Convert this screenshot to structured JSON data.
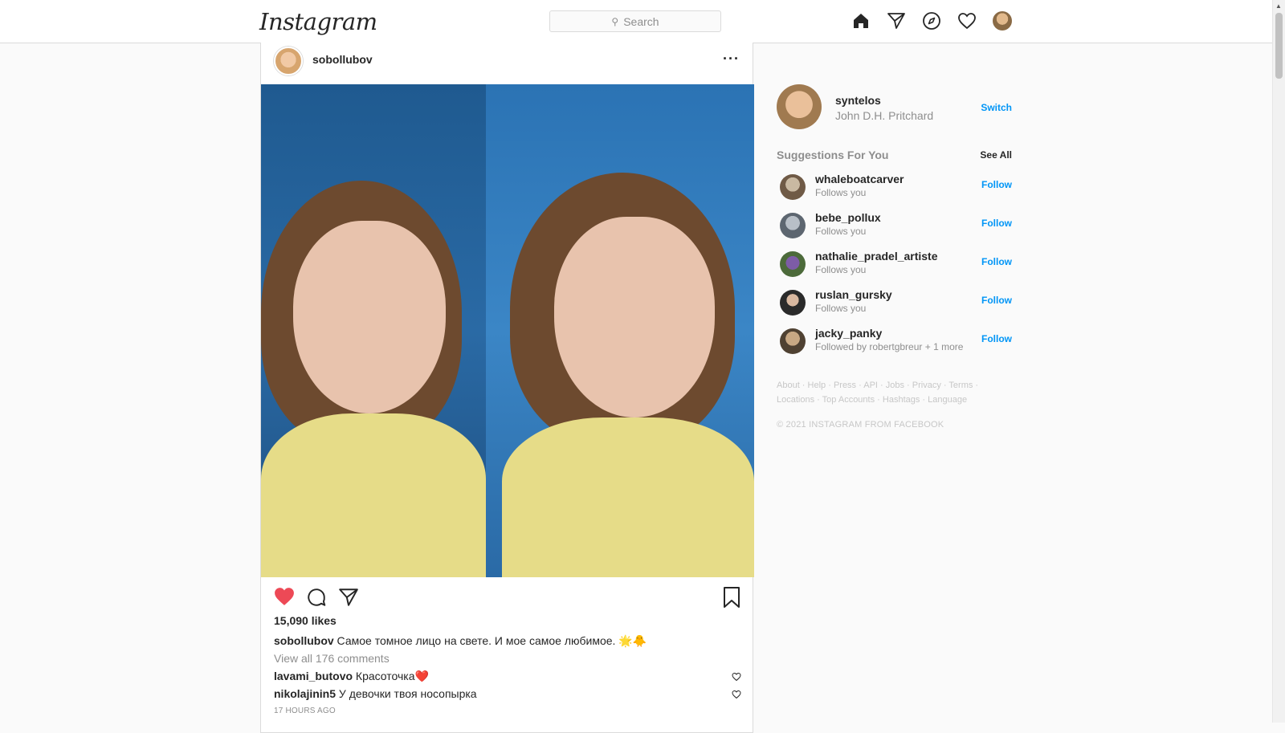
{
  "app": {
    "logo": "Instagram"
  },
  "search": {
    "placeholder": "Search"
  },
  "nav": {
    "icons": [
      "home-icon",
      "direct-icon",
      "explore-icon",
      "activity-heart-icon",
      "profile-avatar"
    ]
  },
  "post": {
    "username": "sobollubov",
    "likes": "15,090 likes",
    "caption_user": "sobollubov",
    "caption_text": " Самое томное лицо на свете. И мое самое любимое. 🌟🐥",
    "view_all": "View all 176 comments",
    "comments": [
      {
        "user": "lavami_butovo",
        "text": " Красоточка❤️"
      },
      {
        "user": "nikolajinin5",
        "text": " У девочки твоя носопырка"
      }
    ],
    "time": "17 HOURS AGO",
    "liked": true,
    "colors": {
      "like": "#ed4956",
      "link": "#0095f6"
    }
  },
  "sidebar": {
    "me": {
      "username": "syntelos",
      "full_name": "John D.H. Pritchard",
      "switch_label": "Switch"
    },
    "suggestions_title": "Suggestions For You",
    "see_all": "See All",
    "follow_label": "Follow",
    "suggestions": [
      {
        "username": "whaleboatcarver",
        "sub": "Follows you"
      },
      {
        "username": "bebe_pollux",
        "sub": "Follows you"
      },
      {
        "username": "nathalie_pradel_artiste",
        "sub": "Follows you"
      },
      {
        "username": "ruslan_gursky",
        "sub": "Follows you"
      },
      {
        "username": "jacky_panky",
        "sub": "Followed by robertgbreur + 1 more"
      }
    ],
    "footer_links": [
      "About",
      "Help",
      "Press",
      "API",
      "Jobs",
      "Privacy",
      "Terms",
      "Locations",
      "Top Accounts",
      "Hashtags",
      "Language"
    ],
    "copyright": "© 2021 INSTAGRAM FROM FACEBOOK"
  }
}
